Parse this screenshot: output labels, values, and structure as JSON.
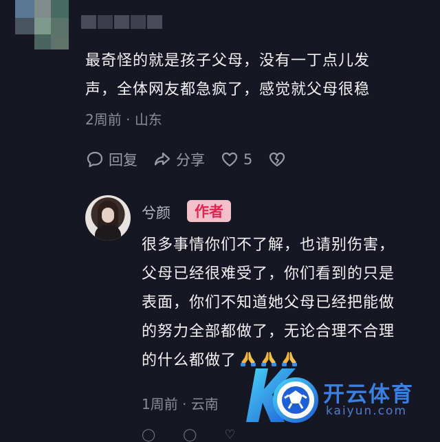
{
  "colors": {
    "background": "#161722",
    "text_primary": "#F2F2F5",
    "text_secondary": "#8B8C98",
    "author_badge_bg": "#F2BFCB",
    "author_badge_text": "#E02650",
    "watermark_blue": "#3b7fe0"
  },
  "comment1": {
    "avatar": "blurred-avatar",
    "username": "blurred-username",
    "lines": [
      "最奇怪的就是孩子父母，没有一丁点儿发",
      "声，全体网友都急疯了，感觉就父母很稳"
    ],
    "time": "2周前",
    "separator": "·",
    "location": "山东",
    "actions": {
      "reply_icon": "chat-bubble-icon",
      "reply_label": "回复",
      "share_icon": "share-arrow-icon",
      "share_label": "分享",
      "like_icon": "heart-icon",
      "like_count": "5",
      "dislike_icon": "broken-heart-icon"
    }
  },
  "comment2": {
    "username": "兮颜",
    "author_badge": "作者",
    "lines": [
      "很多事情你们不了解，也请别伤害，",
      "父母已经很难受了，你们看到的只是",
      "表面，你们不知道她父母已经把能做",
      "的努力全部都做了，无论合理不合理",
      "的什么都做了"
    ],
    "emoji": [
      "folded-hands-emoji",
      "folded-hands-emoji",
      "folded-hands-emoji"
    ],
    "time": "1周前",
    "separator": "·",
    "location": "云南"
  },
  "watermark": {
    "title": "开云体育",
    "subtitle": "kaiyun.com",
    "logo": "kaiyun-soccer-logo"
  }
}
